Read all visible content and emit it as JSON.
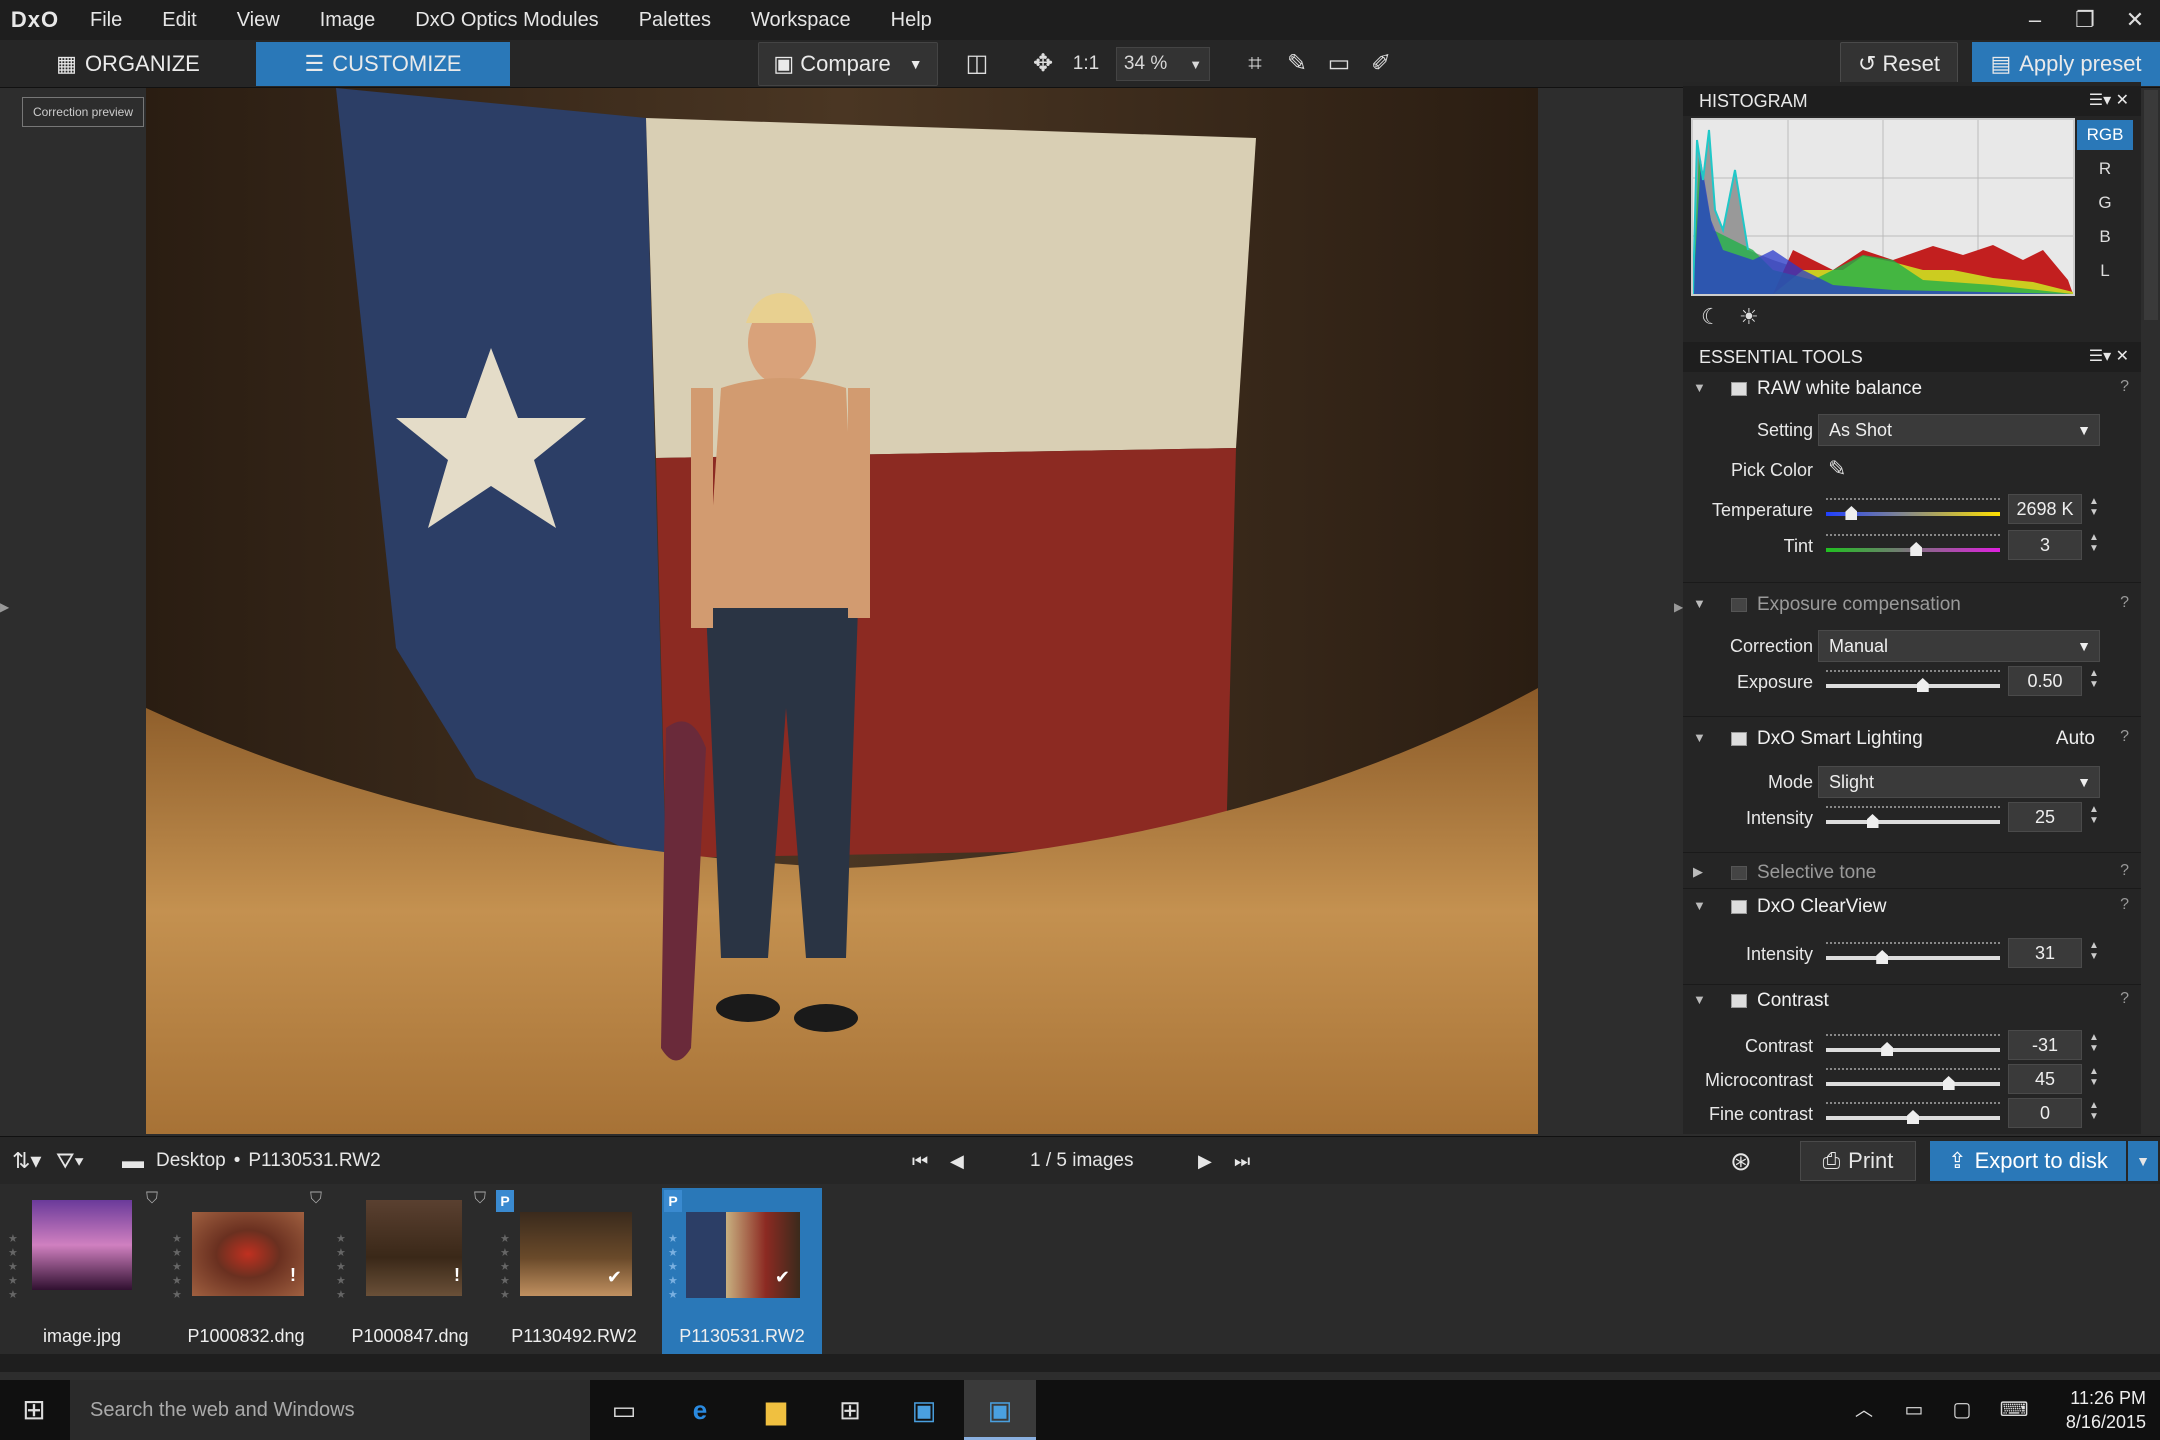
{
  "app": {
    "logo": "DxO"
  },
  "menu": [
    "File",
    "Edit",
    "View",
    "Image",
    "DxO Optics Modules",
    "Palettes",
    "Workspace",
    "Help"
  ],
  "window_controls": {
    "min": "–",
    "restore": "❐",
    "close": "✕"
  },
  "toolbar": {
    "organize": "ORGANIZE",
    "customize": "CUSTOMIZE",
    "compare": "Compare",
    "one_to_one": "1:1",
    "zoom": "34 %",
    "reset": "Reset",
    "apply_preset": "Apply preset"
  },
  "correction_preview": "Correction preview",
  "histogram": {
    "title": "HISTOGRAM",
    "channels": [
      "RGB",
      "R",
      "G",
      "B",
      "L"
    ],
    "active_channel": "RGB"
  },
  "essential_tools": {
    "title": "ESSENTIAL TOOLS",
    "raw_wb": {
      "name": "RAW white balance",
      "setting_label": "Setting",
      "setting_value": "As Shot",
      "pick_color_label": "Pick Color",
      "temperature_label": "Temperature",
      "temperature_value": "2698 K",
      "temperature_level": 0.12,
      "tint_label": "Tint",
      "tint_value": "3",
      "tint_level": 0.52
    },
    "exposure": {
      "name": "Exposure compensation",
      "correction_label": "Correction",
      "correction_value": "Manual",
      "exposure_label": "Exposure",
      "exposure_value": "0.50",
      "exposure_level": 0.56
    },
    "smart_lighting": {
      "name": "DxO Smart Lighting",
      "auto": "Auto",
      "mode_label": "Mode",
      "mode_value": "Slight",
      "intensity_label": "Intensity",
      "intensity_value": "25",
      "intensity_level": 0.25
    },
    "selective_tone": {
      "name": "Selective tone"
    },
    "clearview": {
      "name": "DxO ClearView",
      "intensity_label": "Intensity",
      "intensity_value": "31",
      "intensity_level": 0.31
    },
    "contrast": {
      "name": "Contrast",
      "contrast_label": "Contrast",
      "contrast_value": "-31",
      "contrast_level": 0.34,
      "micro_label": "Microcontrast",
      "micro_value": "45",
      "micro_level": 0.72,
      "fine_label": "Fine contrast",
      "fine_value": "0",
      "fine_level": 0.5
    },
    "help": "?"
  },
  "bottom": {
    "folder": "Desktop",
    "file": "P1130531.RW2",
    "counter": "1 / 5  images",
    "print": "Print",
    "export": "Export to disk"
  },
  "thumbnails": [
    {
      "name": "image.jpg",
      "flag": "",
      "badge": ""
    },
    {
      "name": "P1000832.dng",
      "flag": "",
      "badge": "!"
    },
    {
      "name": "P1000847.dng",
      "flag": "",
      "badge": "!"
    },
    {
      "name": "P1130492.RW2",
      "flag": "P",
      "badge": "✔"
    },
    {
      "name": "P1130531.RW2",
      "flag": "P",
      "badge": "✔"
    }
  ],
  "taskbar": {
    "search": "Search the web and Windows",
    "time": "11:26 PM",
    "date": "8/16/2015"
  }
}
